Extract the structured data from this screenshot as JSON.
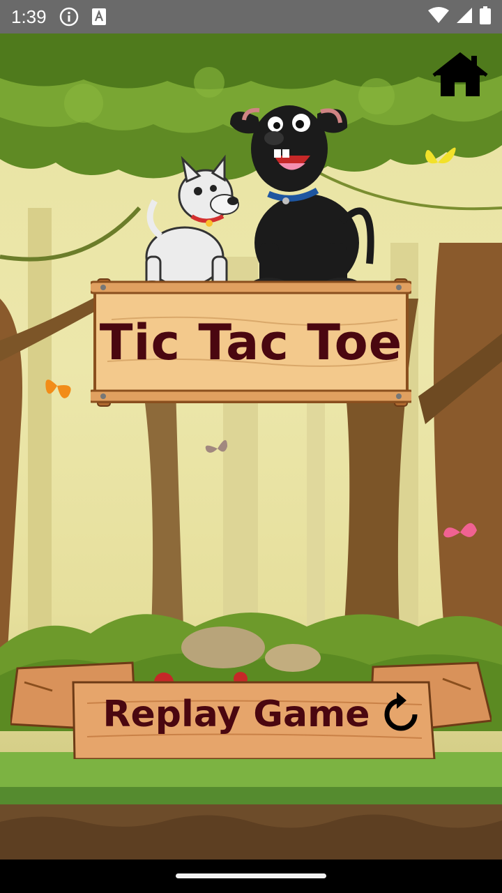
{
  "status_bar": {
    "time": "1:39",
    "icons_left": [
      "info-icon",
      "text-a-icon"
    ],
    "icons_right": [
      "wifi-icon",
      "signal-icon",
      "battery-icon"
    ]
  },
  "game": {
    "title": "Tic Tac Toe",
    "replay_label": "Replay Game",
    "home_icon": "home-icon",
    "replay_icon": "replay-icon",
    "characters": [
      "white-dog",
      "black-dog"
    ],
    "decorations": [
      "butterfly-yellow",
      "butterfly-orange",
      "butterfly-brown",
      "butterfly-pink"
    ]
  },
  "colors": {
    "title_text": "#4a0710",
    "wood": "#f3c98c",
    "wood_dark": "#b9783e",
    "leaf": "#6f9a2c",
    "grass": "#7cb342"
  }
}
